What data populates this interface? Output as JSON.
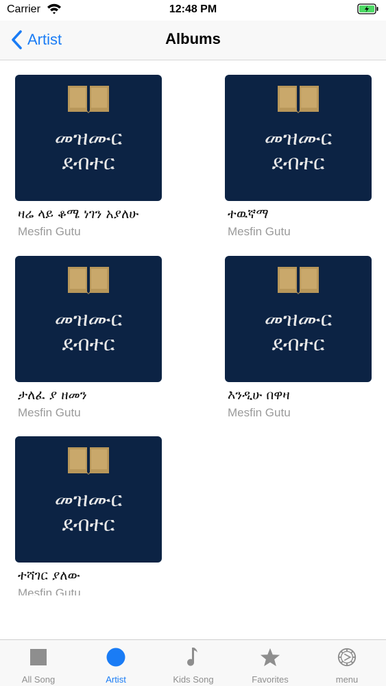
{
  "status_bar": {
    "carrier": "Carrier",
    "time": "12:48 PM"
  },
  "nav": {
    "back_label": "Artist",
    "title": "Albums"
  },
  "cover_art": {
    "line1": "መዝሙር",
    "line2": "ደብተር",
    "background_color": "#0c2344",
    "icon": "open-book-icon"
  },
  "albums": [
    {
      "title": "ዛሬ ላይ ቆሜ ነገን አያለሁ",
      "artist": "Mesfin Gutu"
    },
    {
      "title": "ተዉኛማ",
      "artist": "Mesfin Gutu"
    },
    {
      "title": "ታለፈ ያ ዘመን",
      "artist": "Mesfin Gutu"
    },
    {
      "title": "እንዲሁ በዋዛ",
      "artist": "Mesfin Gutu"
    },
    {
      "title": "ተሻገር ያለው",
      "artist": "Mesfin Gutu"
    }
  ],
  "tabs": [
    {
      "label": "All Song",
      "icon": "square-icon",
      "active": false
    },
    {
      "label": "Artist",
      "icon": "circle-icon",
      "active": true
    },
    {
      "label": "Kids Song",
      "icon": "music-note-icon",
      "active": false
    },
    {
      "label": "Favorites",
      "icon": "star-icon",
      "active": false
    },
    {
      "label": "menu",
      "icon": "menu-gear-icon",
      "active": false
    }
  ],
  "colors": {
    "accent": "#1a7cf5",
    "inactive": "#8e8e8e",
    "subtitle": "#9a9a9a"
  }
}
